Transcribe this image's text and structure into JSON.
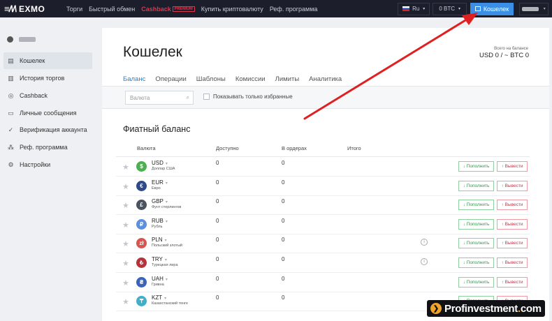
{
  "header": {
    "logo_text": "EXMO",
    "nav": [
      {
        "label": "Торги"
      },
      {
        "label": "Быстрый обмен"
      },
      {
        "label": "Cashback",
        "badge": "PREMIUM"
      },
      {
        "label": "Купить криптовалюту"
      },
      {
        "label": "Реф. программа"
      }
    ],
    "language": "Ru",
    "balance": "0 BTC",
    "wallet_button": "Кошелек"
  },
  "sidebar": {
    "items": [
      {
        "label": "Кошелек",
        "icon": "wallet-icon",
        "active": true
      },
      {
        "label": "История торгов",
        "icon": "history-icon"
      },
      {
        "label": "Cashback",
        "icon": "cashback-icon"
      },
      {
        "label": "Личные сообщения",
        "icon": "messages-icon"
      },
      {
        "label": "Верификация аккаунта",
        "icon": "verification-icon"
      },
      {
        "label": "Реф. программа",
        "icon": "referral-icon"
      },
      {
        "label": "Настройки",
        "icon": "settings-icon"
      }
    ]
  },
  "main": {
    "title": "Кошелек",
    "balance_label": "Всего на балансе",
    "balance_value": "USD 0 / ~ BTC 0",
    "tabs": [
      {
        "label": "Баланс",
        "active": true
      },
      {
        "label": "Операции"
      },
      {
        "label": "Шаблоны"
      },
      {
        "label": "Комиссии"
      },
      {
        "label": "Лимиты"
      },
      {
        "label": "Аналитика"
      }
    ],
    "search_placeholder": "Валюта",
    "favorites_label": "Показывать только избранные",
    "section_title": "Фиатный баланс",
    "columns": [
      "Валюта",
      "Доступно",
      "В ордерах",
      "Итого"
    ],
    "deposit_label": "↓ Пополнить",
    "withdraw_label": "↑ Вывести",
    "rows": [
      {
        "code": "USD",
        "name": "Доллар США",
        "symbol": "$",
        "color": "#4caf50",
        "available": "0",
        "in_orders": "0",
        "info": false
      },
      {
        "code": "EUR",
        "name": "Евро",
        "symbol": "€",
        "color": "#2f4a8a",
        "available": "0",
        "in_orders": "0",
        "info": false
      },
      {
        "code": "GBP",
        "name": "Фунт стерлингов",
        "symbol": "£",
        "color": "#4a5460",
        "available": "0",
        "in_orders": "0",
        "info": false
      },
      {
        "code": "RUB",
        "name": "Рубль",
        "symbol": "₽",
        "color": "#5b8fe0",
        "available": "0",
        "in_orders": "0",
        "info": false
      },
      {
        "code": "PLN",
        "name": "Польский злотый",
        "symbol": "zł",
        "color": "#d9534f",
        "available": "0",
        "in_orders": "0",
        "info": true
      },
      {
        "code": "TRY",
        "name": "Турецкая лира",
        "symbol": "₺",
        "color": "#b5333a",
        "available": "0",
        "in_orders": "0",
        "info": true
      },
      {
        "code": "UAH",
        "name": "Гривна",
        "symbol": "₴",
        "color": "#3b63b8",
        "available": "0",
        "in_orders": "0",
        "info": false
      },
      {
        "code": "KZT",
        "name": "Казахстанский тенге",
        "symbol": "₸",
        "color": "#3fb0c9",
        "available": "0",
        "in_orders": "0",
        "info": false
      }
    ]
  },
  "watermark": {
    "prefix": "Profinvestment",
    "dot": ".",
    "suffix": "com"
  }
}
